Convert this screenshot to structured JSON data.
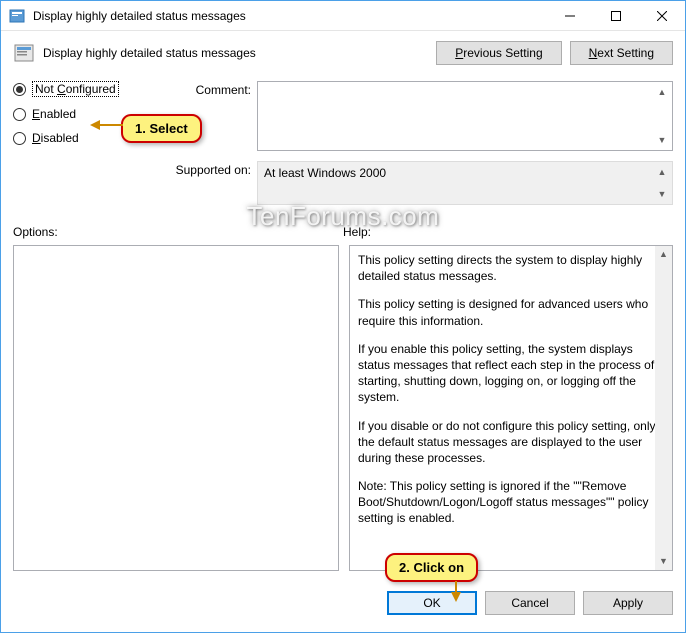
{
  "window": {
    "title": "Display highly detailed status messages"
  },
  "header": {
    "page_title": "Display highly detailed status messages",
    "prev": "Previous Setting",
    "next": "Next Setting"
  },
  "radios": {
    "not_configured": "Not Configured",
    "enabled": "Enabled",
    "disabled": "Disabled"
  },
  "fields": {
    "comment_label": "Comment:",
    "supported_label": "Supported on:",
    "supported_value": "At least Windows 2000"
  },
  "sections": {
    "options_label": "Options:",
    "help_label": "Help:"
  },
  "help": {
    "p1": "This policy setting directs the system to display highly detailed status messages.",
    "p2": "This policy setting is designed for advanced users who require this information.",
    "p3": "If you enable this policy setting, the system displays status messages that reflect each step in the process of starting, shutting down, logging on, or logging off the system.",
    "p4": "If you disable or do not configure this policy setting, only the default status messages are displayed to the user during these processes.",
    "p5": "Note: This policy setting is ignored if the \"\"Remove Boot/Shutdown/Logon/Logoff status messages\"\" policy setting is enabled."
  },
  "footer": {
    "ok": "OK",
    "cancel": "Cancel",
    "apply": "Apply"
  },
  "callouts": {
    "c1": "1. Select",
    "c2": "2. Click on"
  },
  "watermark": "TenForums.com"
}
